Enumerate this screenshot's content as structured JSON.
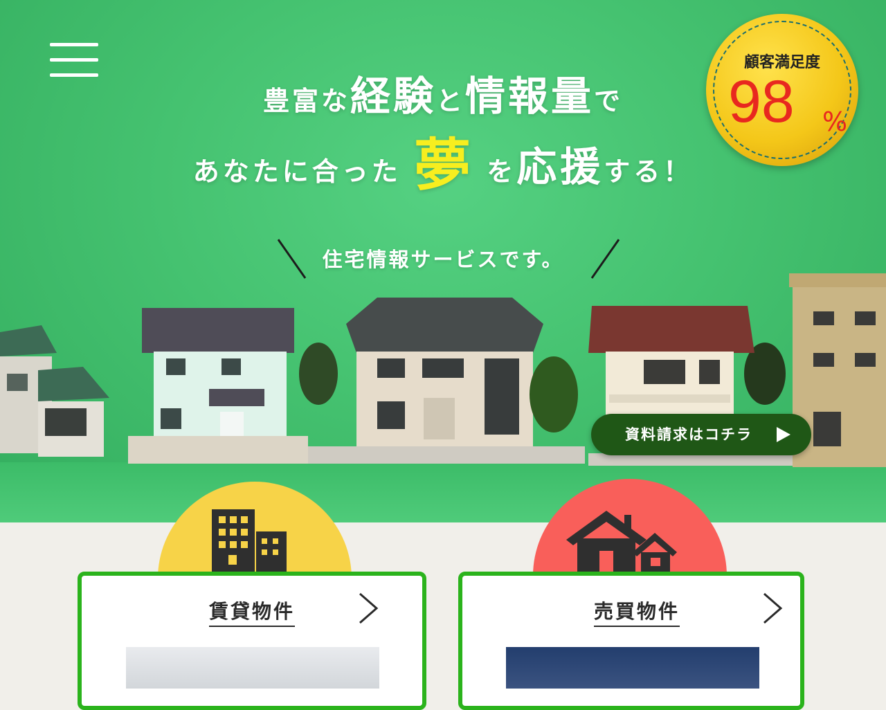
{
  "header": {
    "menu_icon": "hamburger-menu-icon"
  },
  "hero": {
    "line1_a": "豊富な",
    "line1_b": "経験",
    "line1_c": "と",
    "line1_d": "情報量",
    "line1_e": "で",
    "line2_a": "あなたに合った",
    "line2_b": "夢",
    "line2_c": "を",
    "line2_d": "応援",
    "line2_e": "する！",
    "subtitle": "住宅情報サービスです。"
  },
  "badge": {
    "label": "顧客満足度",
    "value": "98",
    "unit": "%"
  },
  "cta": {
    "label": "資料請求はコチラ"
  },
  "categories": [
    {
      "title": "賃貸物件",
      "icon": "apartment-building-icon",
      "circle_color": "#f7d348"
    },
    {
      "title": "売買物件",
      "icon": "house-icon",
      "circle_color": "#f95f5a"
    }
  ],
  "colors": {
    "hero_green": "#45c270",
    "accent_yellow": "#f7ee1f",
    "card_border": "#2bb31c",
    "cta_bg": "#1f5716",
    "badge_red": "#e8281f"
  }
}
